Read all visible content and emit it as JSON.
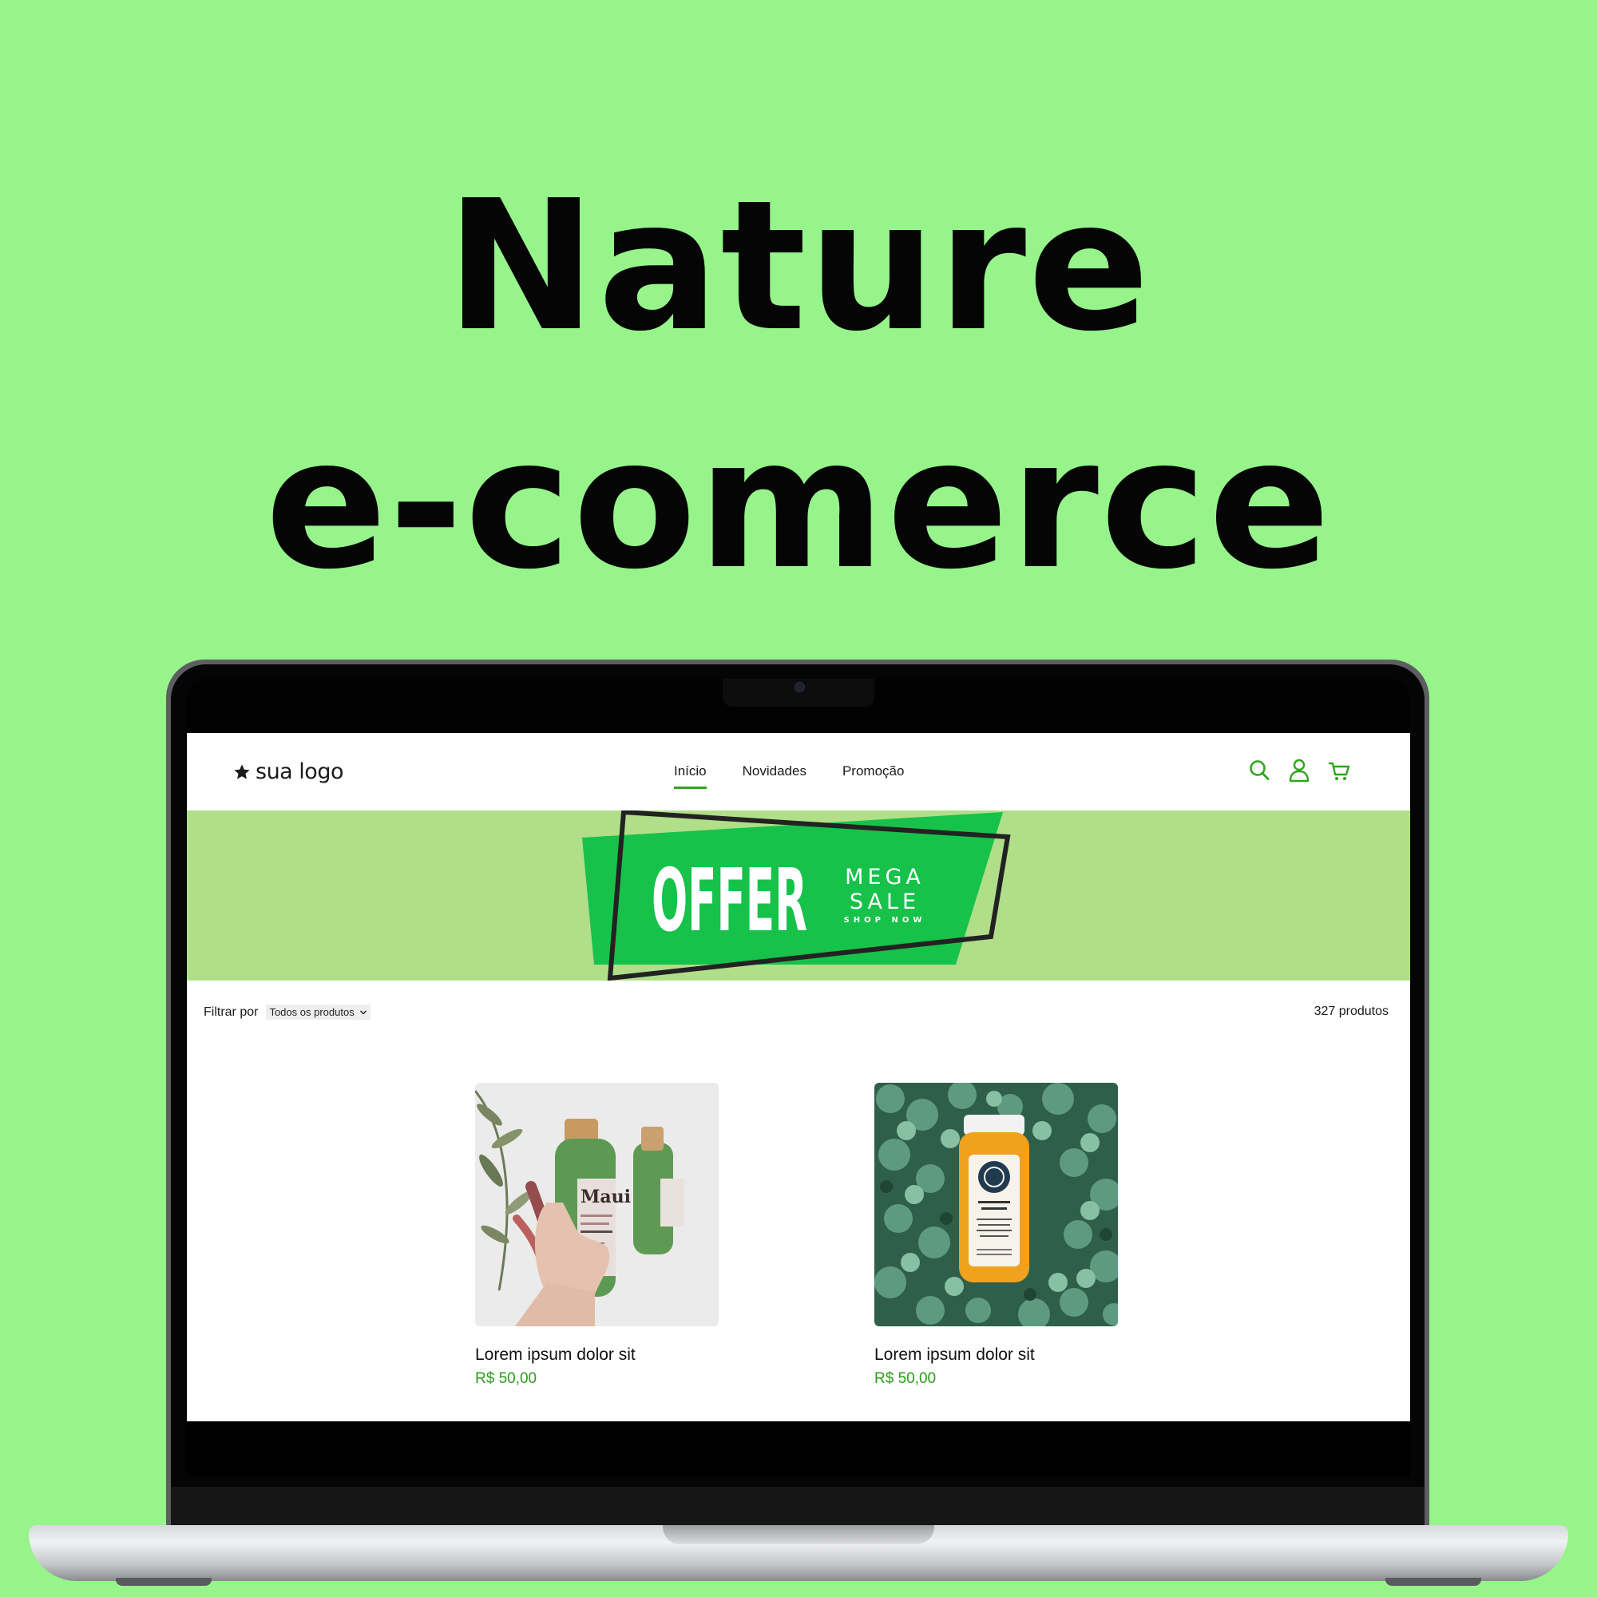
{
  "headline": {
    "line1": "Nature",
    "line2": "e-comerce"
  },
  "colors": {
    "background": "#96f48a",
    "accent": "#2fa51d",
    "price": "#2c9a1a",
    "banner_bg": "#b0de89",
    "banner_green": "#16c24a"
  },
  "site": {
    "logo": {
      "icon": "star-icon",
      "text": "sua logo"
    },
    "nav": [
      {
        "label": "Início",
        "active": true
      },
      {
        "label": "Novidades",
        "active": false
      },
      {
        "label": "Promoção",
        "active": false
      }
    ],
    "icons": [
      "search-icon",
      "user-icon",
      "cart-icon"
    ],
    "banner": {
      "word": "OFFER",
      "line1": "MEGA",
      "line2": "SALE",
      "cta": "SHOP NOW"
    },
    "filter": {
      "label": "Filtrar por",
      "selected": "Todos os produtos"
    },
    "product_count": "327 produtos",
    "products": [
      {
        "title": "Lorem ipsum dolor sit",
        "price": "R$ 50,00",
        "image": "shampoo-bottle-photo"
      },
      {
        "title": "Lorem ipsum dolor sit",
        "price": "R$ 50,00",
        "image": "juice-bottle-on-leaves-photo"
      }
    ]
  }
}
